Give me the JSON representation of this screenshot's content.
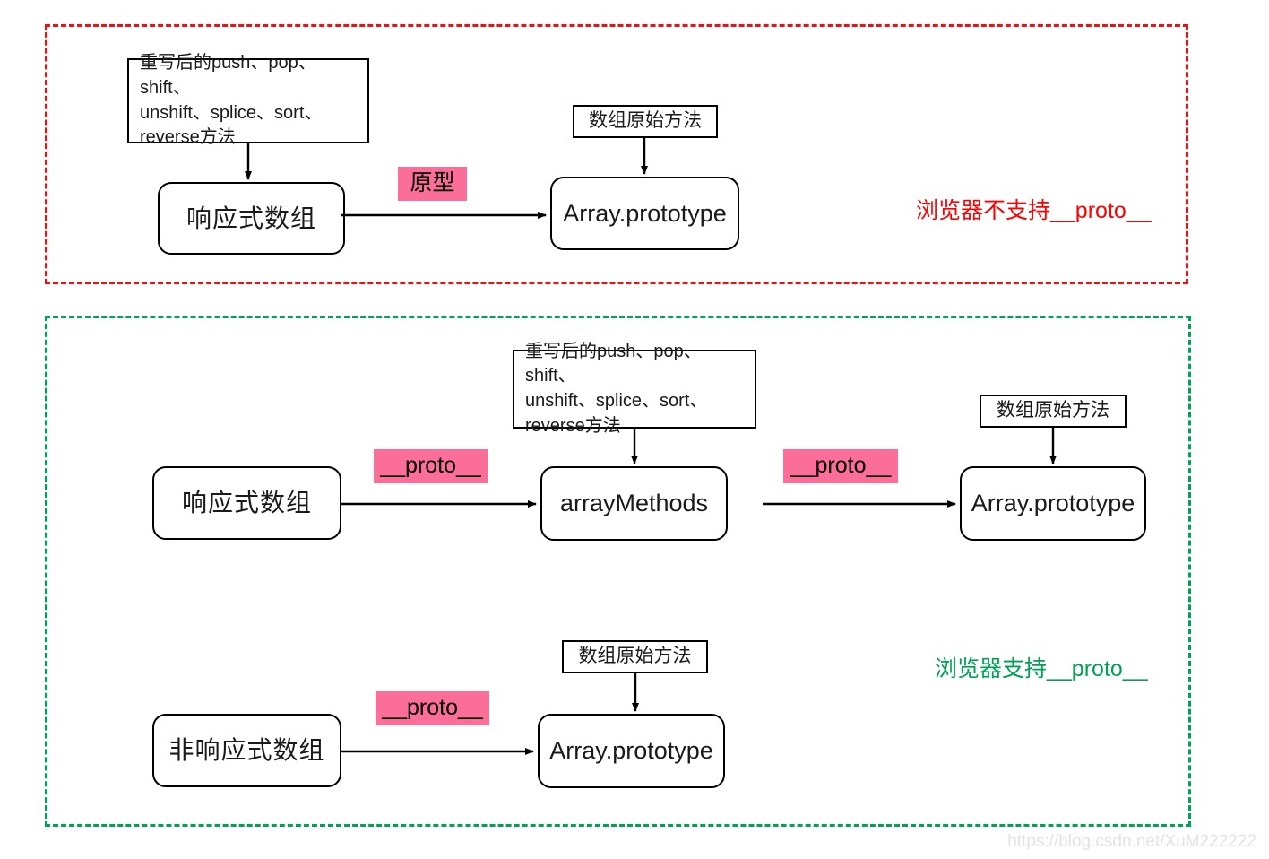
{
  "diagram": {
    "watermark": "https://blog.csdn.net/XuM222222",
    "colors": {
      "red_border": "#ee1111",
      "green_border": "#00a353",
      "pink_highlight": "#fb6e99",
      "red_text": "#ff0000",
      "green_text": "#00a353",
      "node_border": "#000000",
      "background": "#ffffff"
    },
    "groups": [
      {
        "id": "unsupported",
        "caption": "浏览器不支持__proto__",
        "border_color": "#ee1111"
      },
      {
        "id": "supported",
        "caption": "浏览器支持__proto__",
        "border_color": "#00a353"
      }
    ],
    "notes": {
      "overridden_methods": "重写后的push、pop、shift、unshift、splice、sort、reverse方法",
      "overridden_methods_lines": [
        "重写后的push、pop、shift、",
        "unshift、splice、sort、",
        "reverse方法"
      ],
      "native_methods": "数组原始方法"
    },
    "nodes": {
      "reactive_array": "响应式数组",
      "non_reactive_array": "非响应式数组",
      "array_prototype": "Array.prototype",
      "array_methods": "arrayMethods"
    },
    "edge_labels": {
      "prototype_cn": "原型",
      "proto": "__proto__"
    }
  }
}
